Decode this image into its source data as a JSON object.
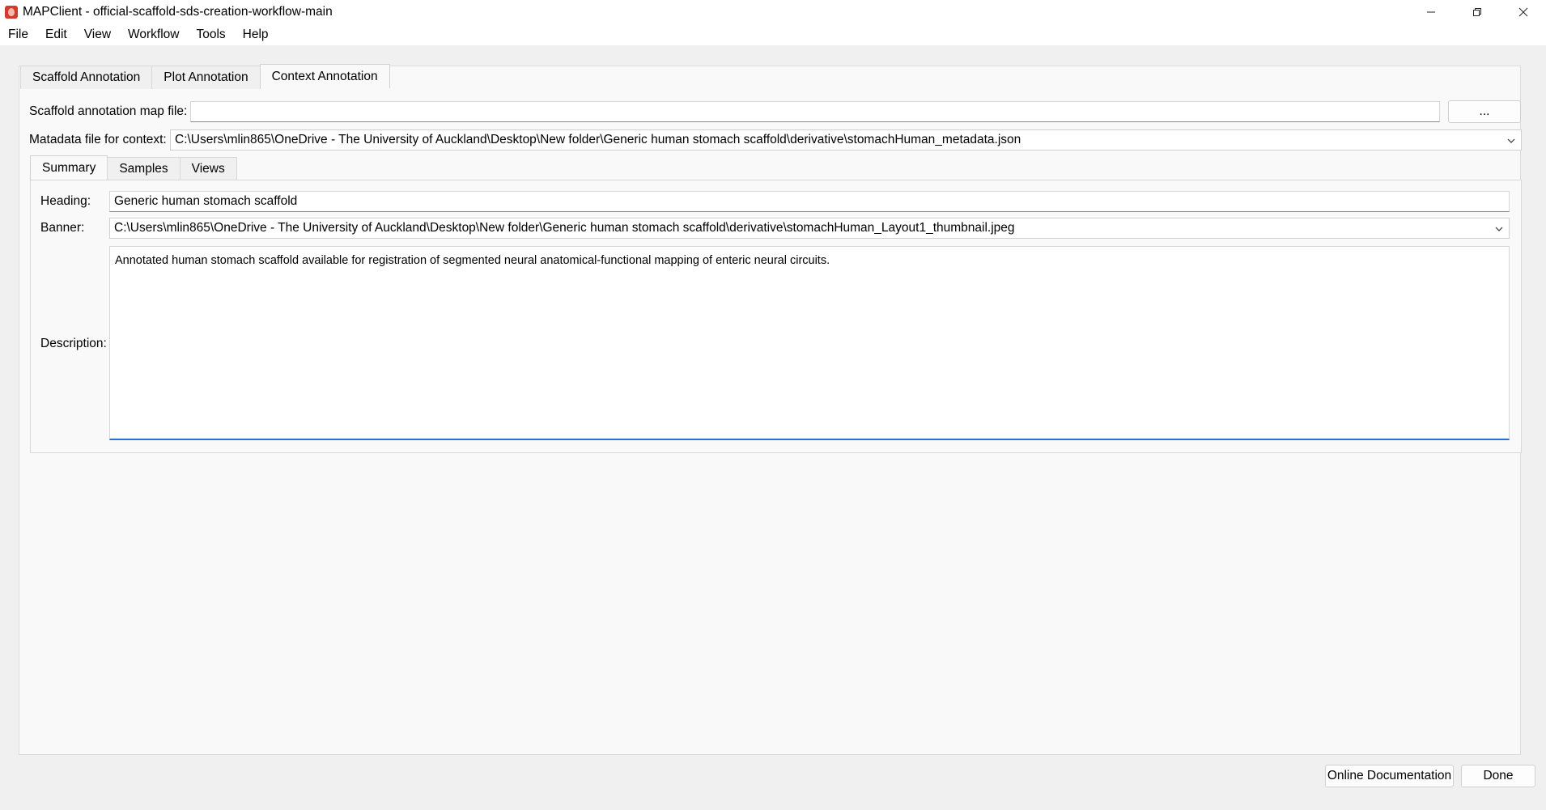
{
  "window": {
    "title": "MAPClient - official-scaffold-sds-creation-workflow-main",
    "icon": "mapclient-app-icon"
  },
  "menu": [
    "File",
    "Edit",
    "View",
    "Workflow",
    "Tools",
    "Help"
  ],
  "top_tabs": [
    {
      "label": "Scaffold Annotation",
      "active": false
    },
    {
      "label": "Plot Annotation",
      "active": false
    },
    {
      "label": "Context Annotation",
      "active": true
    }
  ],
  "scaffold_map": {
    "label": "Scaffold annotation map file:",
    "value": "",
    "browse_label": "..."
  },
  "metadata": {
    "label": "Matadata file for context:",
    "value": "C:\\Users\\mlin865\\OneDrive - The University of Auckland\\Desktop\\New folder\\Generic human stomach scaffold\\derivative\\stomachHuman_metadata.json"
  },
  "inner_tabs": [
    {
      "label": "Summary",
      "active": true
    },
    {
      "label": "Samples",
      "active": false
    },
    {
      "label": "Views",
      "active": false
    }
  ],
  "summary": {
    "heading_label": "Heading:",
    "heading_value": "Generic human stomach scaffold",
    "banner_label": "Banner:",
    "banner_value": "C:\\Users\\mlin865\\OneDrive - The University of Auckland\\Desktop\\New folder\\Generic human stomach scaffold\\derivative\\stomachHuman_Layout1_thumbnail.jpeg",
    "description_label": "Description:",
    "description_value": "Annotated human stomach scaffold available for registration of segmented neural anatomical-functional mapping of enteric neural circuits."
  },
  "footer": {
    "online_docs_label": "Online Documentation",
    "done_label": "Done"
  },
  "colors": {
    "focus_accent": "#2a6fd6",
    "app_icon": "#d23a2f"
  }
}
